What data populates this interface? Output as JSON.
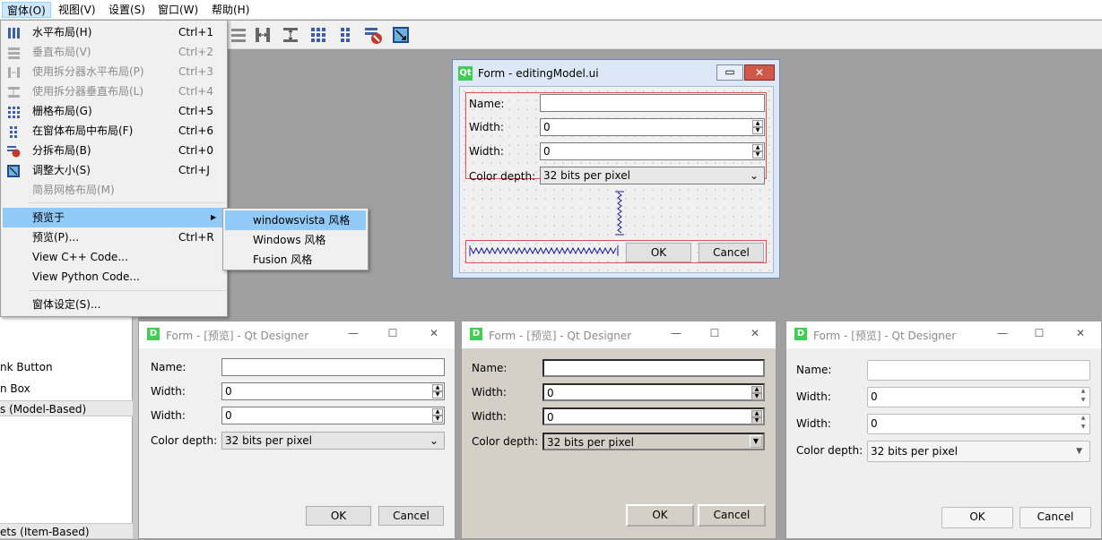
{
  "menubar": {
    "items": [
      "窗体(O)",
      "视图(V)",
      "设置(S)",
      "窗口(W)",
      "帮助(H)"
    ]
  },
  "form_menu": {
    "items": [
      {
        "label": "水平布局(H)",
        "shortcut": "Ctrl+1"
      },
      {
        "label": "垂直布局(V)",
        "shortcut": "Ctrl+2"
      },
      {
        "label": "使用拆分器水平布局(P)",
        "shortcut": "Ctrl+3"
      },
      {
        "label": "使用拆分器垂直布局(L)",
        "shortcut": "Ctrl+4"
      },
      {
        "label": "栅格布局(G)",
        "shortcut": "Ctrl+5"
      },
      {
        "label": "在窗体布局中布局(F)",
        "shortcut": "Ctrl+6"
      },
      {
        "label": "分拆布局(B)",
        "shortcut": "Ctrl+0"
      },
      {
        "label": "调整大小(S)",
        "shortcut": "Ctrl+J"
      },
      {
        "label": "简易网格布局(M)",
        "shortcut": ""
      },
      {
        "label": "预览于",
        "shortcut": ""
      },
      {
        "label": "预览(P)...",
        "shortcut": "Ctrl+R"
      },
      {
        "label": "View C++ Code...",
        "shortcut": ""
      },
      {
        "label": "View Python Code...",
        "shortcut": ""
      },
      {
        "label": "窗体设定(S)...",
        "shortcut": ""
      }
    ]
  },
  "preview_submenu": {
    "items": [
      "windowsvista 风格",
      "Windows 风格",
      "Fusion 风格"
    ]
  },
  "designer_form": {
    "title": "Form - editingModel.ui",
    "name_label": "Name:",
    "width_label_1": "Width:",
    "width_label_2": "Width:",
    "color_label": "Color depth:",
    "width_value_1": "0",
    "width_value_2": "0",
    "color_value": "32 bits per pixel",
    "ok_label": "OK",
    "cancel_label": "Cancel"
  },
  "left_panel": {
    "items": [
      "nk Button",
      "n Box",
      "s (Model-Based)",
      "ets (Item-Based)"
    ]
  },
  "previews": [
    {
      "title": "Form - [预览] - Qt Designer",
      "name_label": "Name:",
      "width_label_1": "Width:",
      "width_label_2": "Width:",
      "color_label": "Color depth:",
      "width_value_1": "0",
      "width_value_2": "0",
      "color_value": "32 bits per pixel",
      "ok_label": "OK",
      "cancel_label": "Cancel"
    },
    {
      "title": "Form - [预览] - Qt Designer",
      "name_label": "Name:",
      "width_label_1": "Width:",
      "width_label_2": "Width:",
      "color_label": "Color depth:",
      "width_value_1": "0",
      "width_value_2": "0",
      "color_value": "32 bits per pixel",
      "ok_label": "OK",
      "cancel_label": "Cancel"
    },
    {
      "title": "Form - [预览] - Qt Designer",
      "name_label": "Name:",
      "width_label_1": "Width:",
      "width_label_2": "Width:",
      "color_label": "Color depth:",
      "width_value_1": "0",
      "width_value_2": "0",
      "color_value": "32 bits per pixel",
      "ok_label": "OK",
      "cancel_label": "Cancel"
    }
  ],
  "colors": {
    "highlight": "#91c9f7",
    "qt_green": "#41cd52",
    "layout_red": "#ff0000"
  }
}
